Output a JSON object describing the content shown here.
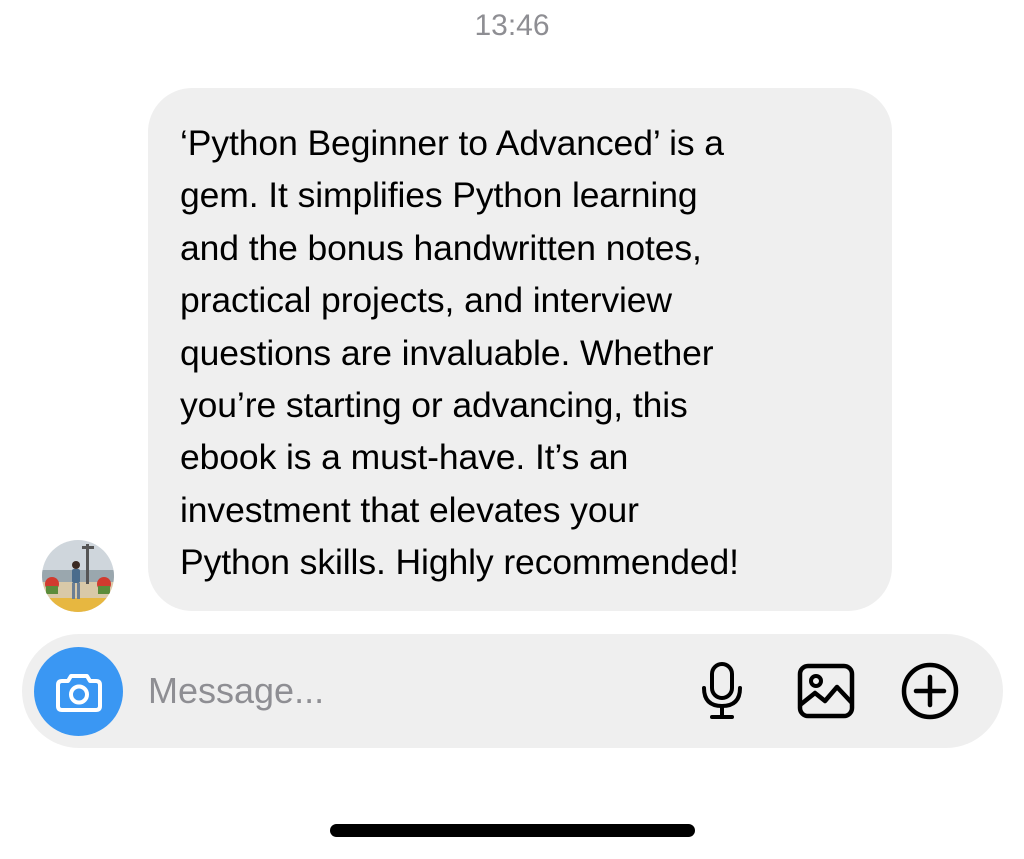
{
  "header": {
    "timestamp": "13:46"
  },
  "conversation": {
    "messages": [
      {
        "sender": "other",
        "avatar_icon": "profile-photo",
        "text": "‘Python Beginner to Advanced’ is a\ngem. It simplifies Python learning\nand the bonus handwritten notes,\npractical projects, and interview\nquestions are invaluable. Whether\nyou’re starting or advancing, this\nebook is a must-have. It’s an\ninvestment that elevates your\nPython skills. Highly recommended!"
      }
    ]
  },
  "composer": {
    "placeholder": "Message...",
    "value": "",
    "camera_icon": "camera-icon",
    "mic_icon": "microphone-icon",
    "gallery_icon": "image-icon",
    "add_icon": "plus-circle-icon",
    "accent_color": "#3a97f3"
  },
  "colors": {
    "bubble_background": "#efefef",
    "timestamp_text": "#8e8e93",
    "composer_background": "#efefef"
  }
}
